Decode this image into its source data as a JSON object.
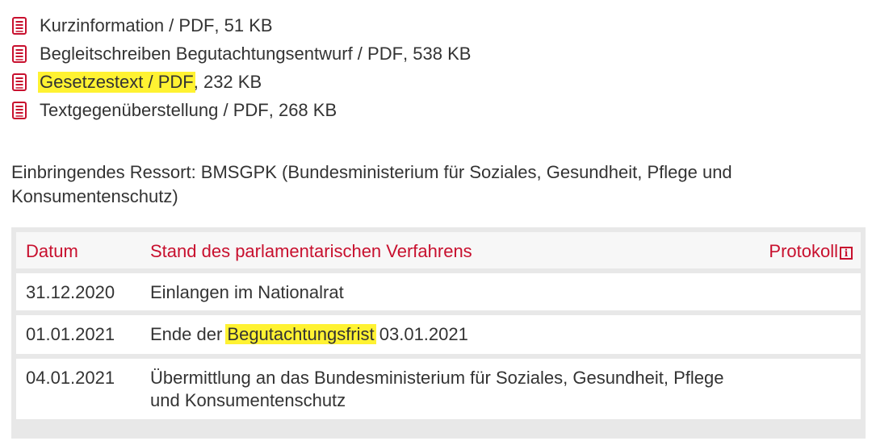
{
  "documents": [
    {
      "name": "Kurzinformation / PDF",
      "suffix": ", 51 KB",
      "icon": "pdf-document-icon"
    },
    {
      "name": "Begleitschreiben Begutachtungsentwurf / PDF",
      "suffix": ", 538 KB",
      "icon": "pdf-document-icon"
    },
    {
      "name": "Gesetzestext / PDF",
      "suffix": ", 232 KB",
      "icon": "pdf-document-icon"
    },
    {
      "name": "Textgegenüberstellung / PDF",
      "suffix": ", 268 KB",
      "icon": "pdf-document-icon"
    }
  ],
  "ressort": "Einbringendes Ressort: BMSGPK (Bundesministerium für Soziales, Gesundheit, Pflege und Konsumentenschutz)",
  "table": {
    "headers": {
      "datum": "Datum",
      "stand": "Stand des parlamentarischen Verfahrens",
      "protokoll": "Protokoll"
    },
    "rows": [
      {
        "datum": "31.12.2020",
        "stand": "Einlangen im Nationalrat"
      },
      {
        "datum": "01.01.2021",
        "stand_prefix": "Ende der ",
        "stand_highlight": "Begutachtungsfrist",
        "stand_suffix": " 03.01.2021"
      },
      {
        "datum": "04.01.2021",
        "stand": "Übermittlung an das Bundesministerium für Soziales, Gesundheit, Pflege und Konsumentenschutz"
      }
    ]
  },
  "colors": {
    "accent": "#c8102e",
    "highlight": "#fff232",
    "table_bg": "#e8e8e8"
  },
  "icons": {
    "info": "info-icon"
  }
}
